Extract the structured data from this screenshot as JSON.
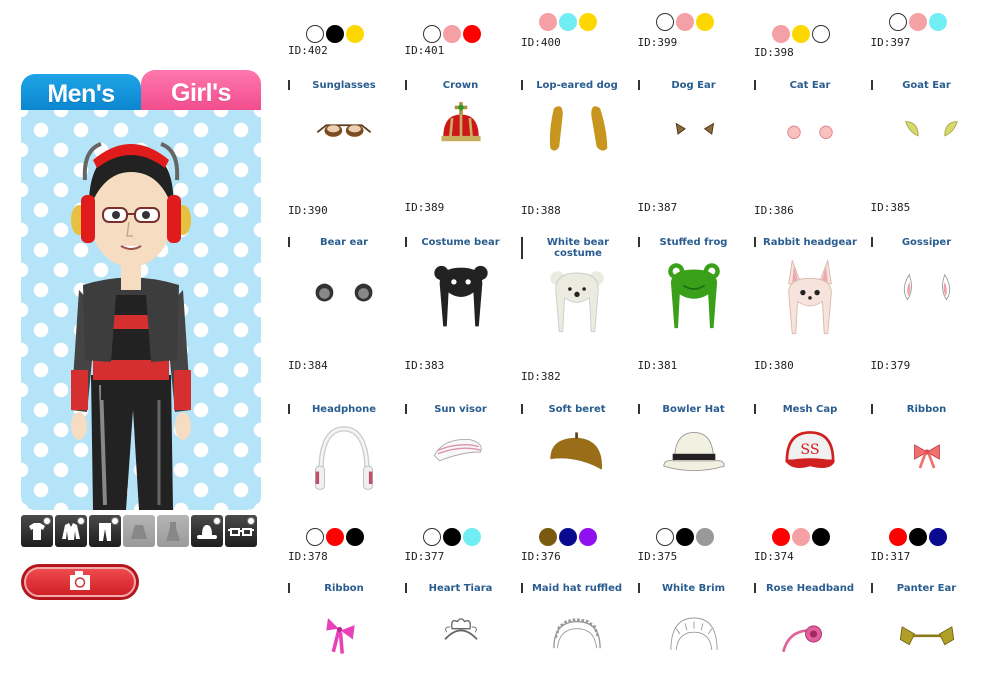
{
  "tabs": {
    "men": "Men's",
    "girls": "Girl's",
    "active": "men"
  },
  "categories": [
    {
      "name": "tops",
      "enabled": true
    },
    {
      "name": "jackets",
      "enabled": true
    },
    {
      "name": "bottoms",
      "enabled": true
    },
    {
      "name": "skirts",
      "enabled": false
    },
    {
      "name": "dresses",
      "enabled": false
    },
    {
      "name": "hats",
      "enabled": true
    },
    {
      "name": "glasses",
      "enabled": true
    }
  ],
  "camera_button": {
    "icon": "camera-icon"
  },
  "items": [
    {
      "row": [
        {
          "id": "ID:402",
          "name": "Sunglasses",
          "colors": [
            "#ffffff",
            "#000000",
            "#ffd700"
          ],
          "art": "sunglasses"
        },
        {
          "id": "ID:401",
          "name": "Crown",
          "colors": [
            "#ffffff",
            "#f4a0a4",
            "#ff0000"
          ],
          "art": "crown"
        },
        {
          "id": "ID:400",
          "name": "Lop-eared dog",
          "colors": [
            "#f4a0a4",
            "#70eef4",
            "#ffd700"
          ],
          "art": "lop"
        },
        {
          "id": "ID:399",
          "name": "Dog Ear",
          "colors": [
            "#ffffff",
            "#f4a0a4",
            "#ffd700"
          ],
          "art": "dogear"
        },
        {
          "id": "ID:398",
          "name": "Cat Ear",
          "colors": [
            "#f4a0a4",
            "#ffd700",
            "#ffffff"
          ],
          "art": "catear"
        },
        {
          "id": "ID:397",
          "name": "Goat Ear",
          "colors": [
            "#ffffff",
            "#f4a0a4",
            "#70eef4"
          ],
          "art": "goatear"
        }
      ]
    },
    {
      "row": [
        {
          "id": "ID:390",
          "name": "Bear ear",
          "colors": [],
          "art": "bearear"
        },
        {
          "id": "ID:389",
          "name": "Costume bear",
          "colors": [],
          "art": "bearblack"
        },
        {
          "id": "ID:388",
          "name": "White bear costume",
          "colors": [],
          "art": "bearwhite"
        },
        {
          "id": "ID:387",
          "name": "Stuffed frog",
          "colors": [],
          "art": "frog"
        },
        {
          "id": "ID:386",
          "name": "Rabbit headgear",
          "colors": [],
          "art": "rabbit"
        },
        {
          "id": "ID:385",
          "name": "Gossiper",
          "colors": [],
          "art": "gossiper"
        }
      ]
    },
    {
      "row": [
        {
          "id": "ID:384",
          "name": "Headphone",
          "colors": [],
          "art": "headphone"
        },
        {
          "id": "ID:383",
          "name": "Sun visor",
          "colors": [],
          "art": "visor"
        },
        {
          "id": "ID:382",
          "name": "Soft beret",
          "colors": [],
          "art": "beret"
        },
        {
          "id": "ID:381",
          "name": "Bowler Hat",
          "colors": [],
          "art": "bowler"
        },
        {
          "id": "ID:380",
          "name": "Mesh Cap",
          "colors": [],
          "art": "cap"
        },
        {
          "id": "ID:379",
          "name": "Ribbon",
          "colors": [],
          "art": "ribbonred"
        }
      ]
    },
    {
      "row": [
        {
          "id": "ID:378",
          "name": "Ribbon",
          "colors": [
            "#ffffff",
            "#ff0000",
            "#000000"
          ],
          "art": "ribbonpink"
        },
        {
          "id": "ID:377",
          "name": "Heart Tiara",
          "colors": [
            "#ffffff",
            "#000000",
            "#70eef4"
          ],
          "art": "tiara"
        },
        {
          "id": "ID:376",
          "name": "Maid hat ruffled",
          "colors": [
            "#7a5a10",
            "#0a0a90",
            "#9010f0"
          ],
          "art": "maid"
        },
        {
          "id": "ID:375",
          "name": "White Brim",
          "colors": [
            "#ffffff",
            "#000000",
            "#999999"
          ],
          "art": "brim"
        },
        {
          "id": "ID:374",
          "name": "Rose Headband",
          "colors": [
            "#ff0000",
            "#f4a0a4",
            "#000000"
          ],
          "art": "rose"
        },
        {
          "id": "ID:317",
          "name": "Panter Ear",
          "colors": [
            "#ff0000",
            "#000000",
            "#0a0a90"
          ],
          "art": "panter"
        }
      ]
    }
  ]
}
